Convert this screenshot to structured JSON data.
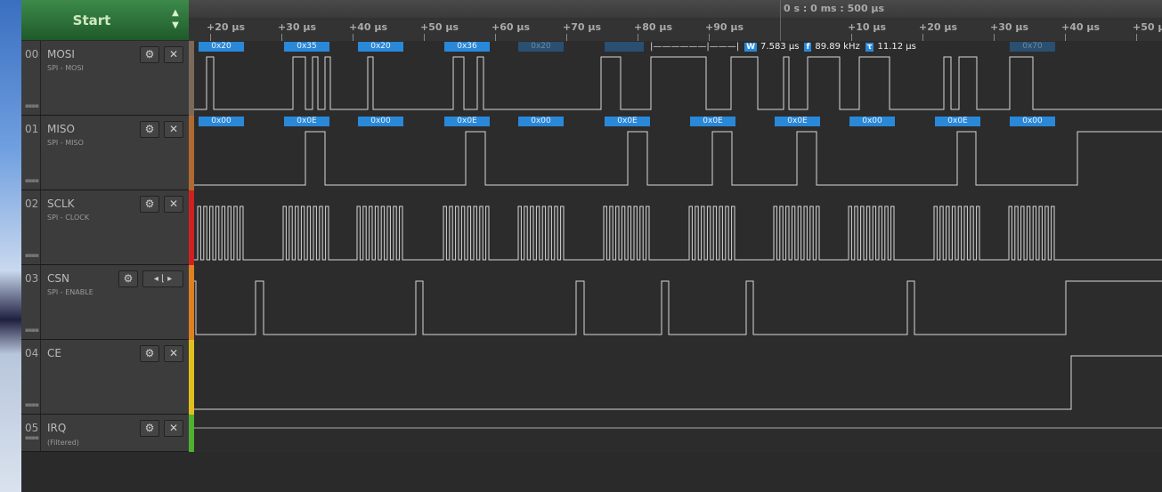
{
  "toolbar": {
    "start_label": "Start",
    "timestamp": "0 s : 0 ms : 500 µs"
  },
  "ruler": {
    "ticks": [
      "+20 µs",
      "+30 µs",
      "+40 µs",
      "+50 µs",
      "+60 µs",
      "+70 µs",
      "+80 µs",
      "+90 µs",
      "+10 µs",
      "+20 µs",
      "+30 µs",
      "+40 µs",
      "+50 µs"
    ]
  },
  "measurement": {
    "width_label": "W",
    "width": "7.583 µs",
    "freq_label": "f",
    "freq": "89.89 kHz",
    "period_label": "τ",
    "period": "11.12 µs"
  },
  "channels": [
    {
      "num": "00",
      "name": "MOSI",
      "sub": "SPI - MOSI",
      "color": "#7a6a5a"
    },
    {
      "num": "01",
      "name": "MISO",
      "sub": "SPI - MISO",
      "color": "#b06a30"
    },
    {
      "num": "02",
      "name": "SCLK",
      "sub": "SPI - CLOCK",
      "color": "#d02020"
    },
    {
      "num": "03",
      "name": "CSN",
      "sub": "SPI - ENABLE",
      "color": "#e08020"
    },
    {
      "num": "04",
      "name": "CE",
      "sub": "",
      "color": "#e0c020"
    },
    {
      "num": "05",
      "name": "IRQ",
      "sub": "(Filtered)",
      "color": "#50b030"
    }
  ],
  "mosi_labels": [
    "0x20",
    "0x35",
    "0x20",
    "0x36",
    "0x20",
    "",
    "0x70"
  ],
  "miso_labels": [
    "0x00",
    "0x0E",
    "0x00",
    "0x0E",
    "0x00",
    "0x0E",
    "0x0E",
    "0x0E",
    "0x00",
    "0x0E",
    "0x00"
  ]
}
